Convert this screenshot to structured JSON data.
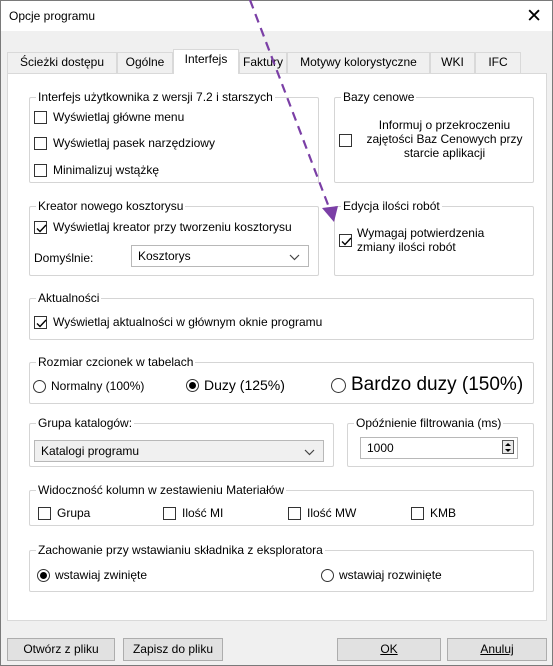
{
  "window": {
    "title": "Opcje programu"
  },
  "tabs": [
    {
      "label": "Ścieżki dostępu"
    },
    {
      "label": "Ogólne"
    },
    {
      "label": "Interfejs"
    },
    {
      "label": "Faktury"
    },
    {
      "label": "Motywy kolorystyczne"
    },
    {
      "label": "WKI"
    },
    {
      "label": "IFC"
    }
  ],
  "active_tab": "Interfejs",
  "interface_72": {
    "legend": "Interfejs użytkownika z wersji 7.2 i starszych",
    "options": [
      {
        "label": "Wyświetlaj główne menu",
        "checked": false
      },
      {
        "label": "Wyświetlaj pasek narzędziowy",
        "checked": false
      },
      {
        "label": "Minimalizuj wstążkę",
        "checked": false
      }
    ]
  },
  "price_bases": {
    "legend": "Bazy cenowe",
    "option": {
      "label": "Informuj o przekroczeniu zajętości Baz Cenowych przy starcie aplikacji",
      "checked": false
    }
  },
  "cost_wizard": {
    "legend": "Kreator nowego kosztorysu",
    "option": {
      "label": "Wyświetlaj kreator przy tworzeniu kosztorysu",
      "checked": true
    },
    "default_label": "Domyślnie:",
    "default_value": "Kosztorys"
  },
  "qty_edit": {
    "legend": "Edycja ilości robót",
    "option": {
      "label": "Wymagaj potwierdzenia zmiany ilości robót",
      "checked": true
    }
  },
  "news": {
    "legend": "Aktualności",
    "option": {
      "label": "Wyświetlaj aktualności w głównym oknie programu",
      "checked": true
    }
  },
  "font_size": {
    "legend": "Rozmiar czcionek w tabelach",
    "options": [
      {
        "label": "Normalny (100%)",
        "selected": false
      },
      {
        "label": "Duzy (125%)",
        "selected": true
      },
      {
        "label": "Bardzo duzy (150%)",
        "selected": false
      }
    ]
  },
  "catalogs": {
    "legend": "Grupa katalogów:",
    "value": "Katalogi programu"
  },
  "filter_delay": {
    "legend": "Opóźnienie filtrowania (ms)",
    "value": "1000"
  },
  "columns": {
    "legend": "Widoczność kolumn w zestawieniu Materiałów",
    "options": [
      {
        "label": "Grupa",
        "checked": false
      },
      {
        "label": "Ilość MI",
        "checked": false
      },
      {
        "label": "Ilość MW",
        "checked": false
      },
      {
        "label": "KMB",
        "checked": false
      }
    ]
  },
  "explorer": {
    "legend": "Zachowanie przy wstawianiu składnika z eksploratora",
    "options": [
      {
        "label": "wstawiaj zwinięte",
        "selected": true
      },
      {
        "label": "wstawiaj rozwinięte",
        "selected": false
      }
    ]
  },
  "buttons": {
    "open": "Otwórz z pliku",
    "save": "Zapisz do pliku",
    "ok": "OK",
    "cancel": "Anuluj"
  },
  "colors": {
    "annotation_arrow": "#7b3fa6",
    "accent_check": "#000000"
  }
}
